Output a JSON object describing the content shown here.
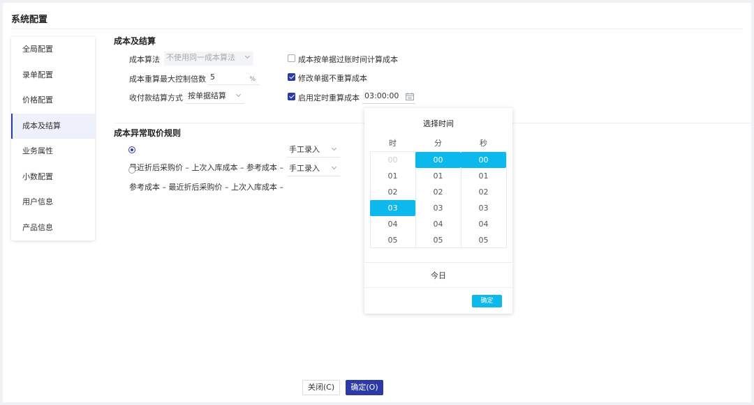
{
  "title": "系统配置",
  "sidebar": {
    "items": [
      {
        "label": "全局配置"
      },
      {
        "label": "录单配置"
      },
      {
        "label": "价格配置"
      },
      {
        "label": "成本及结算"
      },
      {
        "label": "业务属性"
      },
      {
        "label": "小数配置"
      },
      {
        "label": "用户信息"
      },
      {
        "label": "产品信息"
      }
    ],
    "active": "成本及结算"
  },
  "section_cost": {
    "title": "成本及结算",
    "algorithm_label": "成本算法",
    "algorithm_value": "不使用同一成本算法",
    "recalc_max_label": "成本重算最大控制倍数",
    "recalc_max_value": "5",
    "recalc_max_unit": "%",
    "settle_label": "收付款结算方式",
    "settle_value": "按单据结算",
    "options": {
      "post_time": {
        "label": "成本按单据过账时间计算成本",
        "checked": false
      },
      "no_recalc_on_edit": {
        "label": "修改单据不重算成本",
        "checked": true
      },
      "timed_recalc": {
        "label": "启用定时重算成本",
        "checked": true,
        "time_value": "03:00:00"
      }
    }
  },
  "section_abnormal": {
    "title": "成本异常取价规则",
    "rule1": {
      "text": "",
      "select_value": "手工录入",
      "selected": true
    },
    "rule2": {
      "text": "最近折后采购价 – 上次入库成本 – 参考成本 –",
      "select_value": "手工录入",
      "selected": false
    },
    "rule3": {
      "text": "参考成本 – 最近折后采购价 – 上次入库成本 –"
    }
  },
  "time_picker": {
    "title": "选择时间",
    "headers": [
      "时",
      "分",
      "秒"
    ],
    "hours": [
      "00",
      "01",
      "02",
      "03",
      "04",
      "05"
    ],
    "minutes": [
      "00",
      "01",
      "02",
      "03",
      "04",
      "05"
    ],
    "seconds": [
      "00",
      "01",
      "02",
      "03",
      "04",
      "05"
    ],
    "selected": {
      "hour": "03",
      "minute": "00",
      "second": "00"
    },
    "today_label": "今日",
    "confirm_label": "确定"
  },
  "footer": {
    "close_label": "关闭(C)",
    "confirm_label": "确定(O)"
  },
  "colors": {
    "accent": "#2b3aa6",
    "picker_highlight": "#0db8ec"
  }
}
